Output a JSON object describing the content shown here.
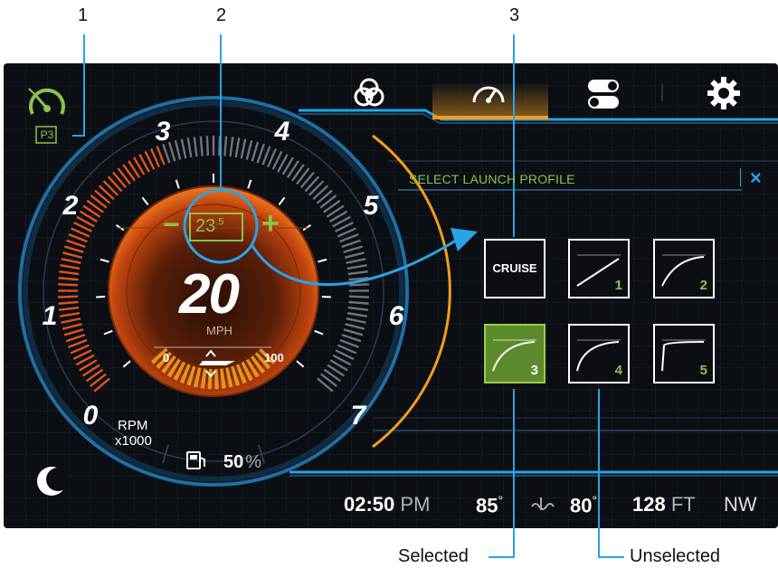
{
  "callouts": {
    "one": "1",
    "two": "2",
    "three": "3"
  },
  "profile_indicator": {
    "label": "P3"
  },
  "gauge": {
    "rpm_ticks": [
      "0",
      "1",
      "2",
      "3",
      "4",
      "5",
      "6",
      "7"
    ],
    "rpm_label": "RPM",
    "rpm_unit": "x1000",
    "setpoint_whole": "23",
    "setpoint_decimal": ".5",
    "minus": "−",
    "plus": "+",
    "speed": "20",
    "speed_unit": "MPH",
    "trim_min": "0",
    "trim_max": "100"
  },
  "fuel": {
    "value": "50",
    "unit": "%"
  },
  "panel": {
    "title": "SELECT LAUNCH PROFILE",
    "close": "×"
  },
  "profiles": [
    {
      "label": "CRUISE",
      "num": "",
      "selected": false
    },
    {
      "label": "",
      "num": "1",
      "selected": false
    },
    {
      "label": "",
      "num": "2",
      "selected": false
    },
    {
      "label": "",
      "num": "3",
      "selected": true
    },
    {
      "label": "",
      "num": "4",
      "selected": false
    },
    {
      "label": "",
      "num": "5",
      "selected": false
    }
  ],
  "status": {
    "time": "02:50",
    "ampm": "PM",
    "air_temp": "85",
    "water_temp": "80",
    "degree": "°",
    "depth": "128",
    "depth_unit": "FT",
    "heading": "NW"
  },
  "annotations": {
    "selected": "Selected",
    "unselected": "Unselected"
  },
  "colors": {
    "accent_orange": "#f39c1f",
    "accent_blue": "#29a3e6",
    "selected_green": "#8bc34a"
  }
}
